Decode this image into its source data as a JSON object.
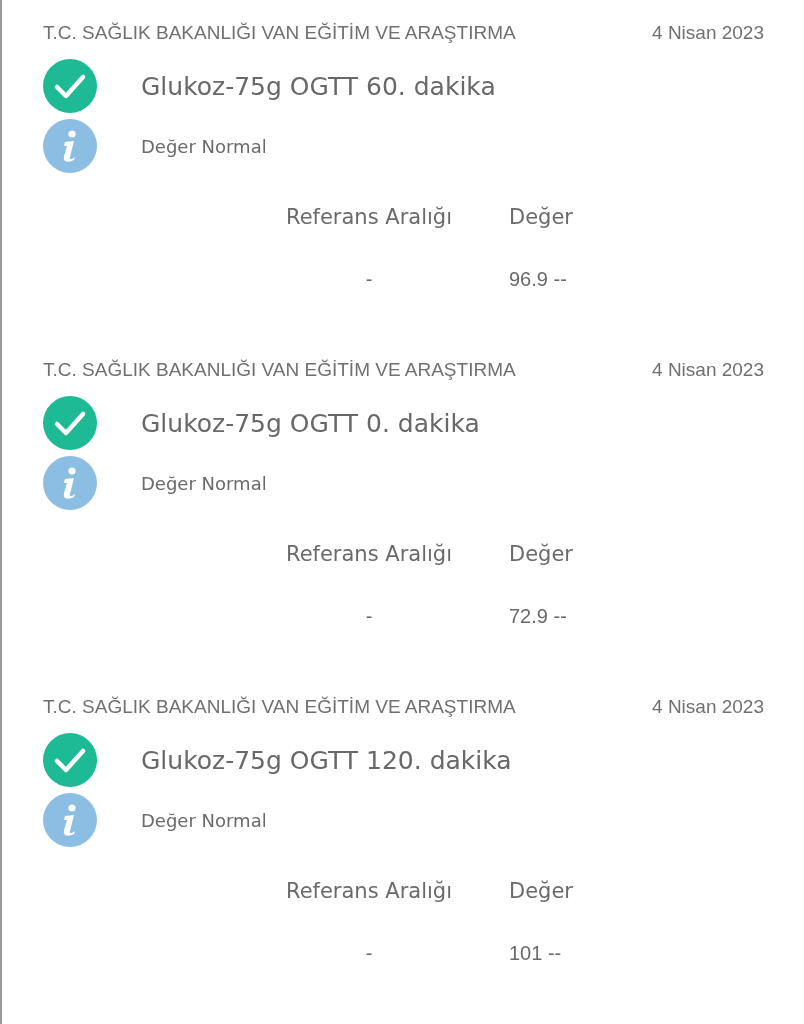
{
  "results": [
    {
      "institution": "T.C. SAĞLIK BAKANLIĞI VAN EĞİTİM VE ARAŞTIRMA",
      "date": "4 Nisan 2023",
      "test": "Glukoz-75g OGTT 60. dakika",
      "note": "Değer Normal",
      "columns": [
        "Referans Aralığı",
        "Değer"
      ],
      "values": [
        "-",
        "96.9 --"
      ]
    },
    {
      "institution": "T.C. SAĞLIK BAKANLIĞI VAN EĞİTİM VE ARAŞTIRMA",
      "date": "4 Nisan 2023",
      "test": "Glukoz-75g OGTT 0. dakika",
      "note": "Değer Normal",
      "columns": [
        "Referans Aralığı",
        "Değer"
      ],
      "values": [
        "-",
        "72.9 --"
      ]
    },
    {
      "institution": "T.C. SAĞLIK BAKANLIĞI VAN EĞİTİM VE ARAŞTIRMA",
      "date": "4 Nisan 2023",
      "test": "Glukoz-75g OGTT 120. dakika",
      "note": "Değer Normal",
      "columns": [
        "Referans Aralığı",
        "Değer"
      ],
      "values": [
        "-",
        "101 --"
      ]
    }
  ]
}
